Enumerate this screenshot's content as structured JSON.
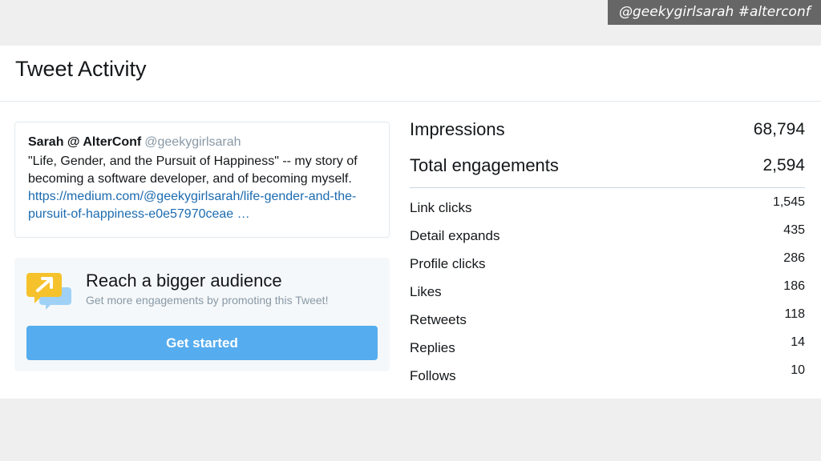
{
  "banner": {
    "text": "@geekygirlsarah #alterconf"
  },
  "header": {
    "title": "Tweet Activity"
  },
  "tweet": {
    "author_name": "Sarah @ AlterConf",
    "author_handle": "@geekygirlsarah",
    "text": "\"Life, Gender, and the Pursuit of Happiness\" -- my story of becoming a software developer, and of becoming myself. ",
    "link": "https://medium.com/@geekygirlsarah/life-gender-and-the-pursuit-of-happiness-e0e57970ceae …"
  },
  "promo": {
    "icon": "promote-arrow-icon",
    "title": "Reach a bigger audience",
    "subtitle": "Get more engagements by promoting this Tweet!",
    "button_label": "Get started"
  },
  "stats": {
    "major": [
      {
        "label": "Impressions",
        "value": "68,794"
      },
      {
        "label": "Total engagements",
        "value": "2,594"
      }
    ],
    "minor": [
      {
        "label": "Link clicks",
        "value": "1,545"
      },
      {
        "label": "Detail expands",
        "value": "435"
      },
      {
        "label": "Profile clicks",
        "value": "286"
      },
      {
        "label": "Likes",
        "value": "186"
      },
      {
        "label": "Retweets",
        "value": "118"
      },
      {
        "label": "Replies",
        "value": "14"
      },
      {
        "label": "Follows",
        "value": "10"
      }
    ]
  },
  "colors": {
    "button": "#55acee",
    "link": "#1b6bb0",
    "icon_yellow": "#f5c22b",
    "icon_blue": "#9fd1f6"
  }
}
